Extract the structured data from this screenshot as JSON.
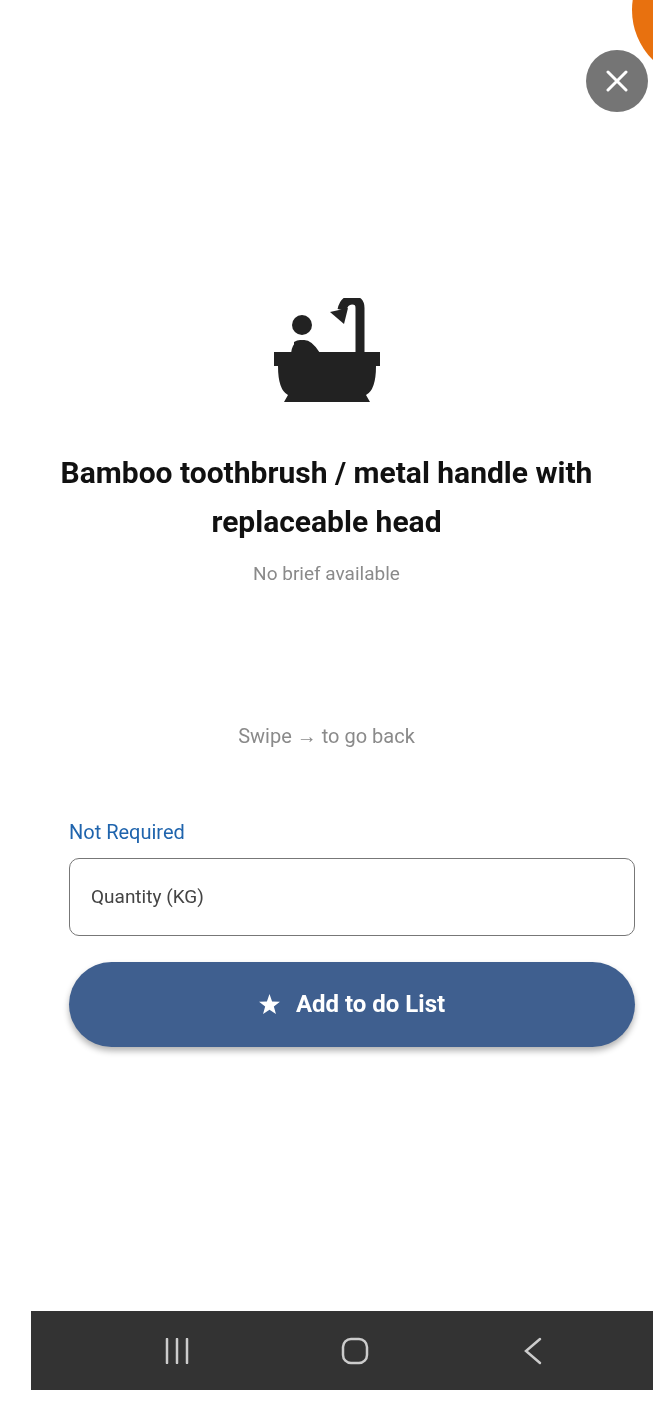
{
  "item": {
    "title": "Bamboo toothbrush / metal handle with replaceable head",
    "brief": "No brief available"
  },
  "swipe_hint": "Swipe → to go back",
  "quantity_field": {
    "label": "Not Required",
    "placeholder": "Quantity (KG)"
  },
  "add_button": {
    "label": "Add to do List"
  }
}
